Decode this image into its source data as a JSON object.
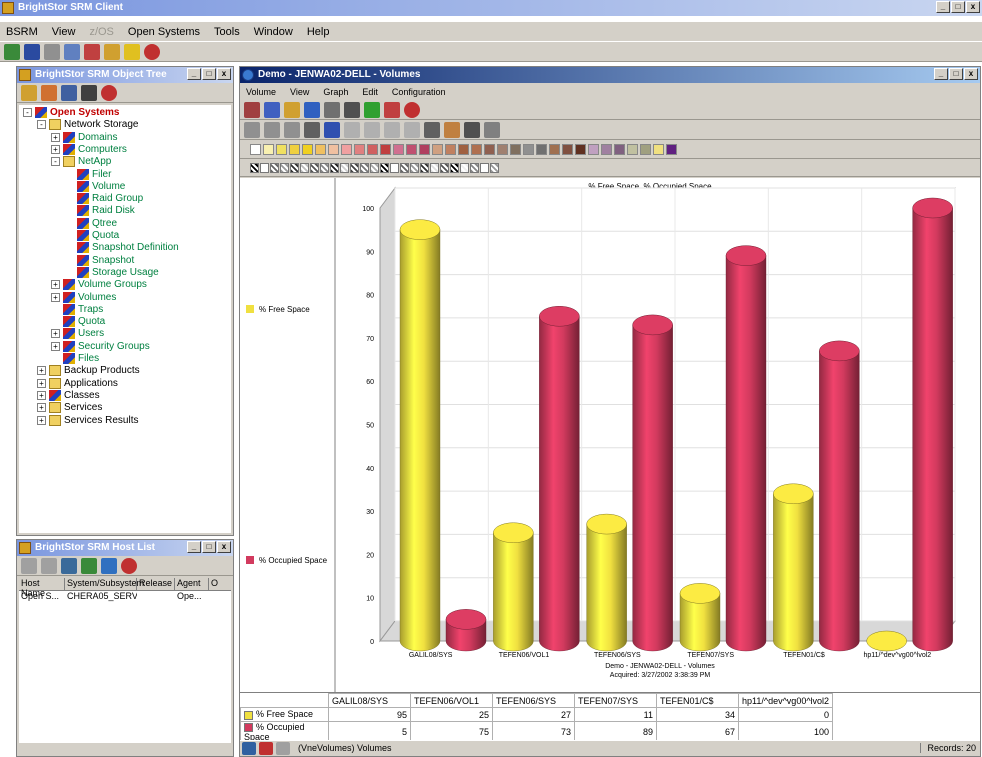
{
  "app": {
    "title": "BrightStor SRM Client",
    "menu": [
      "BSRM",
      "View",
      "z/OS",
      "Open Systems",
      "Tools",
      "Window",
      "Help"
    ]
  },
  "object_tree": {
    "title": "BrightStor SRM Object Tree",
    "items": [
      {
        "label": "Open Systems",
        "level": 0,
        "style": "root",
        "exp": "-"
      },
      {
        "label": "Network Storage",
        "level": 1,
        "style": "folder",
        "exp": "-"
      },
      {
        "label": "Domains",
        "level": 2,
        "style": "node",
        "exp": "+"
      },
      {
        "label": "Computers",
        "level": 2,
        "style": "node",
        "exp": "+"
      },
      {
        "label": "NetApp",
        "level": 2,
        "style": "folder",
        "exp": "-"
      },
      {
        "label": "Filer",
        "level": 3,
        "style": "node",
        "exp": ""
      },
      {
        "label": "Volume",
        "level": 3,
        "style": "node",
        "exp": ""
      },
      {
        "label": "Raid Group",
        "level": 3,
        "style": "node",
        "exp": ""
      },
      {
        "label": "Raid Disk",
        "level": 3,
        "style": "node",
        "exp": ""
      },
      {
        "label": "Qtree",
        "level": 3,
        "style": "node",
        "exp": ""
      },
      {
        "label": "Quota",
        "level": 3,
        "style": "node",
        "exp": ""
      },
      {
        "label": "Snapshot Definition",
        "level": 3,
        "style": "node",
        "exp": ""
      },
      {
        "label": "Snapshot",
        "level": 3,
        "style": "node",
        "exp": ""
      },
      {
        "label": "Storage Usage",
        "level": 3,
        "style": "node",
        "exp": ""
      },
      {
        "label": "Volume Groups",
        "level": 2,
        "style": "node",
        "exp": "+"
      },
      {
        "label": "Volumes",
        "level": 2,
        "style": "node",
        "exp": "+"
      },
      {
        "label": "Traps",
        "level": 2,
        "style": "node",
        "exp": ""
      },
      {
        "label": "Quota",
        "level": 2,
        "style": "node",
        "exp": ""
      },
      {
        "label": "Users",
        "level": 2,
        "style": "node",
        "exp": "+"
      },
      {
        "label": "Security Groups",
        "level": 2,
        "style": "node",
        "exp": "+"
      },
      {
        "label": "Files",
        "level": 2,
        "style": "node",
        "exp": ""
      },
      {
        "label": "Backup Products",
        "level": 1,
        "style": "folder",
        "exp": "+"
      },
      {
        "label": "Applications",
        "level": 1,
        "style": "folder",
        "exp": "+"
      },
      {
        "label": "Classes",
        "level": 1,
        "style": "node",
        "exp": "+"
      },
      {
        "label": "Services",
        "level": 1,
        "style": "folder",
        "exp": "+"
      },
      {
        "label": "Services Results",
        "level": 1,
        "style": "folder",
        "exp": "+"
      }
    ]
  },
  "host_list": {
    "title": "BrightStor SRM Host List",
    "columns": [
      "Host Name",
      "System/Subsystem",
      "Release",
      "Agent",
      "O"
    ],
    "rows": [
      [
        "Open S...",
        "CHERA05_SERV...",
        "",
        "Ope...",
        ""
      ]
    ]
  },
  "chart_window": {
    "title": "Demo - JENWA02-DELL - Volumes",
    "menu": [
      "Volume",
      "View",
      "Graph",
      "Edit",
      "Configuration"
    ]
  },
  "chart_data": {
    "type": "bar",
    "title": "% Free Space, % Occupied Space",
    "categories": [
      "GALIL08/SYS",
      "TEFEN06/VOL1",
      "TEFEN06/SYS",
      "TEFEN07/SYS",
      "TEFEN01/C$",
      "hp11/^dev^vg00^lvol2"
    ],
    "series": [
      {
        "name": "% Free Space",
        "values": [
          95,
          25,
          27,
          11,
          34,
          0
        ],
        "color": "#f0e040"
      },
      {
        "name": "% Occupied Space",
        "values": [
          5,
          75,
          73,
          89,
          67,
          100
        ],
        "color": "#d23a5e"
      }
    ],
    "ylim": [
      0,
      100
    ],
    "yticks": [
      0,
      10,
      20,
      30,
      40,
      50,
      60,
      70,
      80,
      90,
      100
    ],
    "footer_line1": "Demo - JENWA02-DELL - Volumes",
    "footer_line2": "Acquired: 3/27/2002 3:38:39 PM",
    "legend": "left"
  },
  "status": {
    "text": "(VneVolumes) Volumes",
    "records": "Records: 20"
  }
}
